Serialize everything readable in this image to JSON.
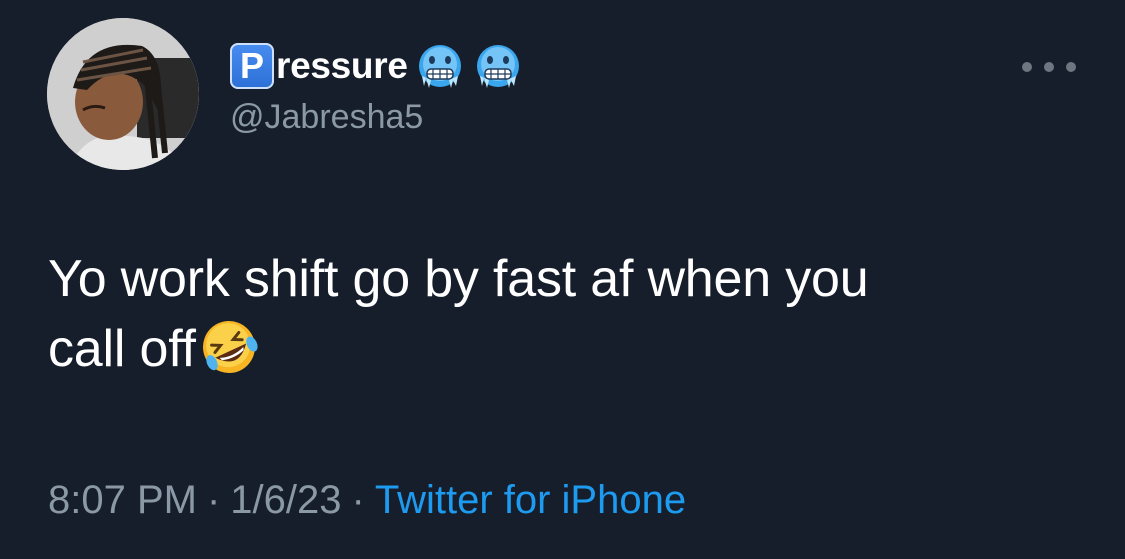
{
  "author": {
    "badge_letter": "P",
    "display_name": "ressure",
    "handle": "@Jabresha5",
    "name_emojis": [
      "cold-face-icon",
      "cold-face-icon"
    ]
  },
  "tweet": {
    "text_line1": "Yo work shift go by fast af when you",
    "text_line2": "call off",
    "trailing_emoji": "rolling-on-floor-laughing-icon"
  },
  "meta": {
    "time": "8:07 PM",
    "separator": "·",
    "date": "1/6/23",
    "source": "Twitter for iPhone"
  },
  "colors": {
    "background": "#171e2b",
    "text": "#ffffff",
    "muted": "#8b98a5",
    "link": "#1d9bf0"
  }
}
